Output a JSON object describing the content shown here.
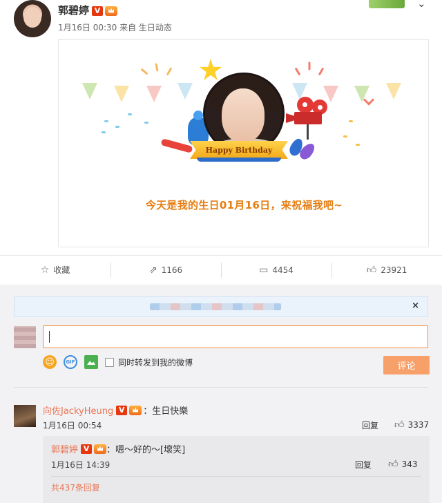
{
  "post": {
    "author": "郭碧婷",
    "verified_badge": "V",
    "meta": "1月16日 00:30 来自 生日动态",
    "birthday_card": {
      "ribbon_text": "Happy Birthday",
      "message": "今天是我的生日01月16日，来祝福我吧~"
    }
  },
  "actions": [
    {
      "icon": "star-icon",
      "label": "收藏"
    },
    {
      "icon": "share-icon",
      "label": "1166"
    },
    {
      "icon": "comment-icon",
      "label": "4454"
    },
    {
      "icon": "like-icon",
      "label": "23921"
    }
  ],
  "comment_box": {
    "notice_close": "×",
    "input_value": "",
    "repost_checkbox_label": "同时转发到我的微博",
    "submit_label": "评论",
    "gif_label": "GIF"
  },
  "comment": {
    "author": "向佐JackyHeung",
    "verified_badge": "V",
    "text": "：生日快樂",
    "time": "1月16日 00:54",
    "reply_label": "回复",
    "likes": "3337",
    "sub_reply": {
      "author": "郭碧婷",
      "verified_badge": "V",
      "text": "：嗯～好的～[壞笑]",
      "time": "1月16日 14:39",
      "reply_label": "回复",
      "likes": "343"
    },
    "total_replies": "共437条回复"
  },
  "colors": {
    "accent_orange": "#eb7350",
    "submit_orange": "#f7a06a",
    "birthday_text": "#e67e12"
  }
}
